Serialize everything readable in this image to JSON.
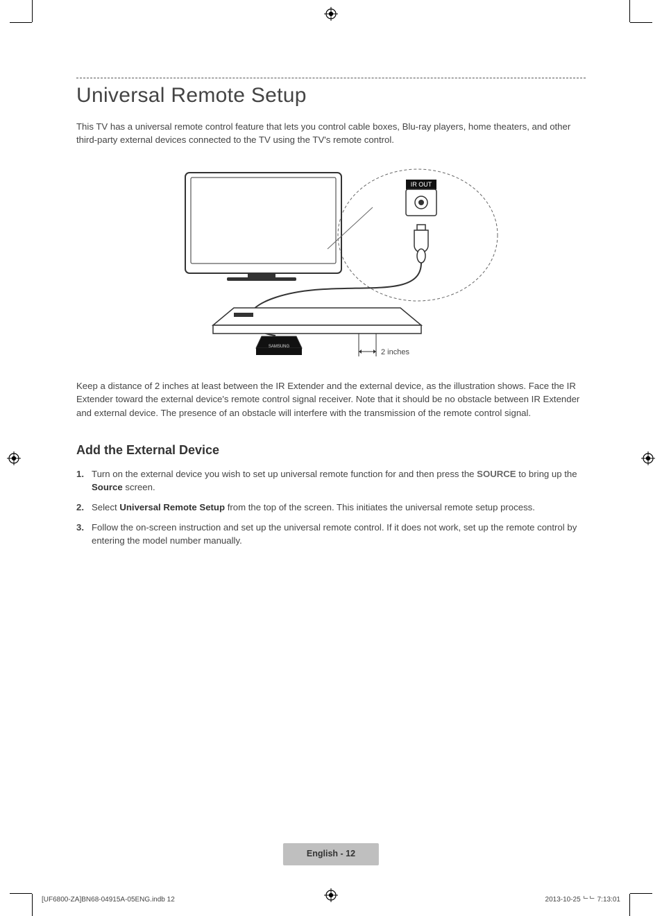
{
  "heading": "Universal Remote Setup",
  "intro": "This TV has a universal remote control feature that lets you control cable boxes, Blu-ray players, home theaters, and other third-party external devices connected to the TV using the TV's remote control.",
  "diagram": {
    "port_label": "IR OUT",
    "distance_label": "2 inches",
    "device_brand": "SAMSUNG"
  },
  "caption": "Keep a distance of 2 inches at least between the IR Extender and the external device, as the illustration shows. Face the IR Extender toward the external device's remote control signal receiver. Note that it should be no obstacle between IR Extender and external device. The presence of an obstacle will interfere with the transmission of the remote control signal.",
  "subheading": "Add the External Device",
  "steps": [
    {
      "num": "1.",
      "prefix": "Turn on the external device you wish to set up universal remote function for and then press the ",
      "btn": "SOURCE",
      "mid": " to bring up the ",
      "strong": "Source",
      "suffix": " screen."
    },
    {
      "num": "2.",
      "prefix": "Select ",
      "strong": "Universal Remote Setup",
      "suffix": " from the top of the screen. This initiates the universal remote setup process."
    },
    {
      "num": "3.",
      "text": "Follow the on-screen instruction and set up the universal remote control. If it does not work, set up the remote control by entering the model number manually."
    }
  ],
  "footer": "English - 12",
  "imposition_left": "[UF6800-ZA]BN68-04915A-05ENG.indb   12",
  "imposition_right": "2013-10-25   ᄂᄂ 7:13:01"
}
